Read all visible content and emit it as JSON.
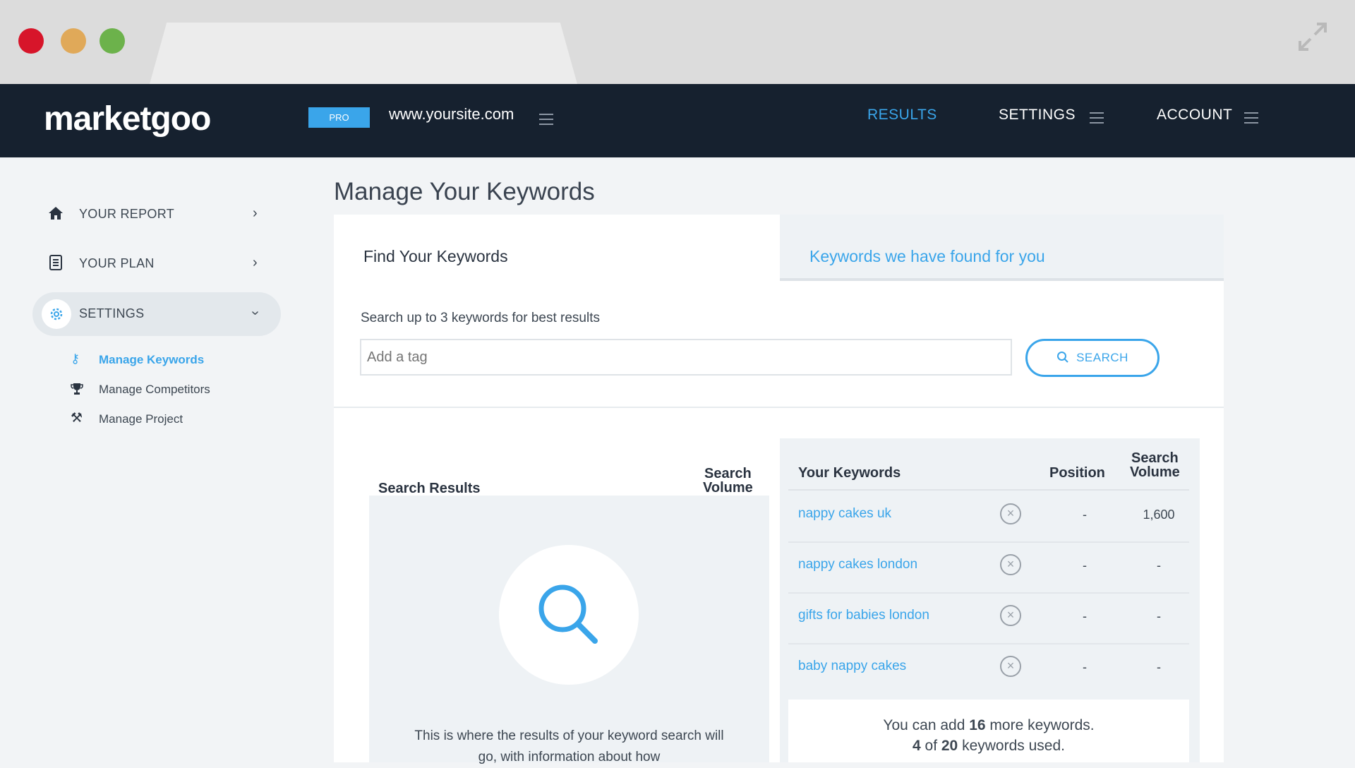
{
  "chrome": {
    "colors": {
      "close": "#d7152a",
      "minimize": "#e0a959",
      "maximize": "#6cb24b"
    }
  },
  "topnav": {
    "logo": "marketgoo",
    "plan_badge": "PRO",
    "site": "www.yoursite.com",
    "links": [
      {
        "label": "RESULTS",
        "active": true
      },
      {
        "label": "SETTINGS"
      },
      {
        "label": "ACCOUNT"
      }
    ]
  },
  "sidebar": {
    "items": [
      {
        "label": "YOUR REPORT",
        "icon": "home-icon"
      },
      {
        "label": "YOUR PLAN",
        "icon": "document-icon"
      },
      {
        "label": "SETTINGS",
        "icon": "gear-icon",
        "expanded": true
      }
    ],
    "subitems": [
      {
        "label": "Manage Keywords",
        "icon": "key-icon",
        "active": true
      },
      {
        "label": "Manage Competitors",
        "icon": "trophy-icon"
      },
      {
        "label": "Manage Project",
        "icon": "tools-icon"
      }
    ]
  },
  "main": {
    "title": "Manage Your Keywords",
    "tabs": [
      {
        "label": "Find Your Keywords",
        "active": true
      },
      {
        "label": "Keywords we have found for you"
      }
    ],
    "hint": "Search up to 3 keywords for best results",
    "tag_placeholder": "Add a tag",
    "search_button": "SEARCH",
    "results": {
      "header": "Search Results",
      "volume_header_line1": "Search",
      "volume_header_line2": "Volume",
      "empty_text": "This is where the results of your keyword search will go, with information about how"
    },
    "keywords": {
      "header": "Your Keywords",
      "position_header": "Position",
      "volume_header_line1": "Search",
      "volume_header_line2": "Volume",
      "rows": [
        {
          "keyword": "nappy cakes uk",
          "position": "-",
          "volume": "1,600"
        },
        {
          "keyword": "nappy cakes london",
          "position": "-",
          "volume": "-"
        },
        {
          "keyword": "gifts for babies london",
          "position": "-",
          "volume": "-"
        },
        {
          "keyword": "baby nappy cakes",
          "position": "-",
          "volume": "-"
        }
      ],
      "footer": {
        "line1_prefix": "You can add ",
        "remaining": "16",
        "line1_suffix": " more keywords.",
        "used": "4",
        "of": " of ",
        "limit": "20",
        "line2_suffix": " keywords used."
      }
    }
  },
  "colors": {
    "accent": "#3aa5ea",
    "nav_bg": "#16212f",
    "text": "#3d4752"
  }
}
